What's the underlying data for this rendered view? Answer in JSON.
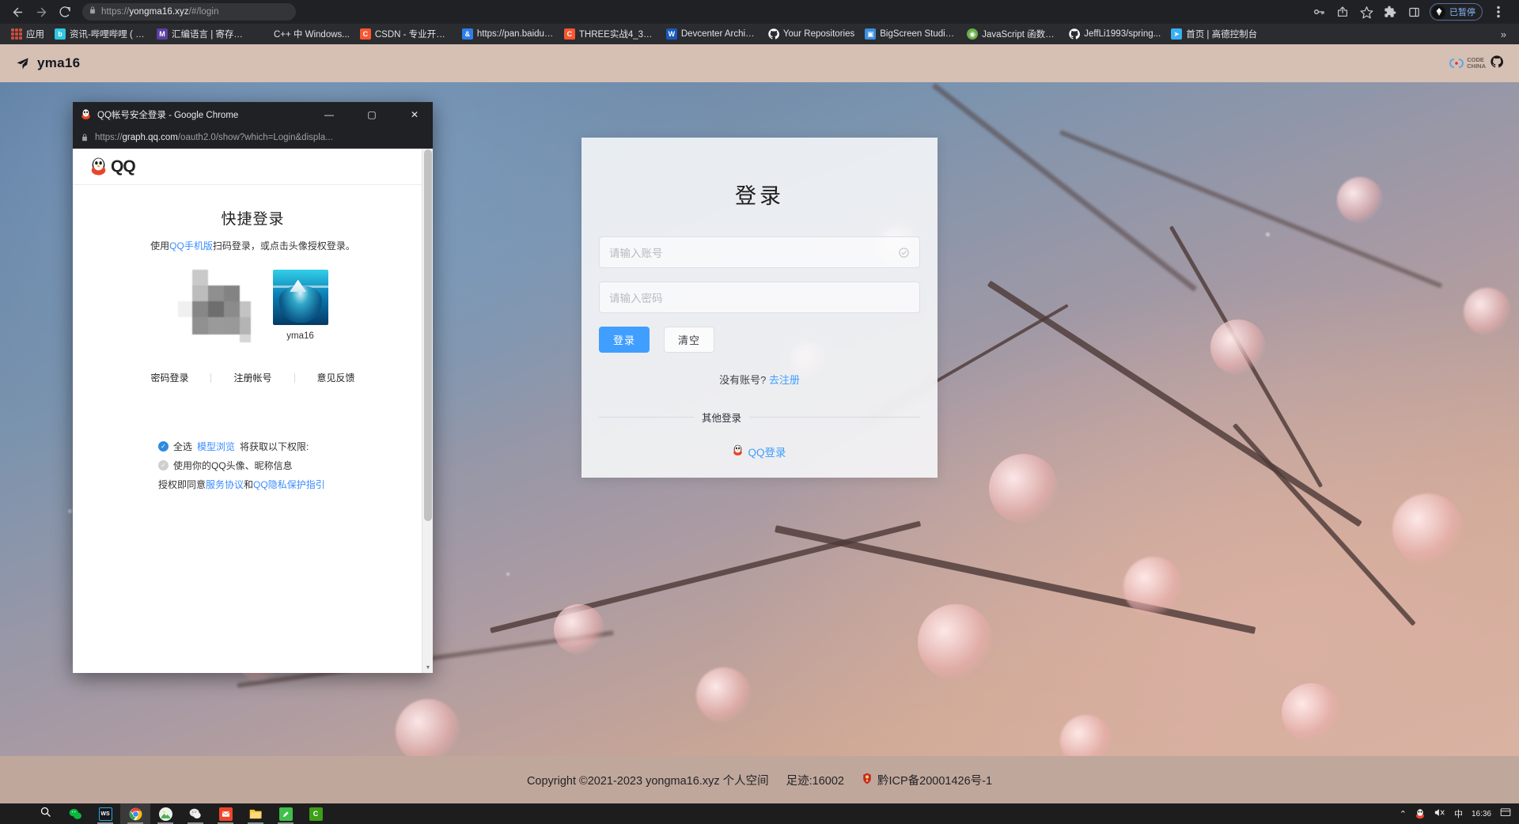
{
  "browser": {
    "nav": {
      "back_icon": "arrow-left-icon",
      "forward_icon": "arrow-right-icon",
      "reload_icon": "reload-icon",
      "lock_icon": "lock-icon",
      "url_prefix": "https://",
      "url_domain": "yongma16.xyz",
      "url_path": "/#/login",
      "full_url": "https://yongma16.xyz/#/login"
    },
    "actions": {
      "key_icon": "key-icon",
      "share_icon": "share-icon",
      "bookmark_icon": "star-icon",
      "extensions_icon": "puzzle-icon",
      "sidepanel_icon": "side-panel-icon",
      "menu_icon": "three-dot-menu-icon",
      "ext_badge_label": "已暂停"
    },
    "bookmarks": {
      "apps_label": "应用",
      "overflow_label": "»",
      "items": [
        {
          "label": "资讯-哔哩哔哩 ( °-...",
          "color": "#2ec7e0",
          "glyph": "b"
        },
        {
          "label": "汇编语言 | 寄存器 -...",
          "color": "#5b3fa3",
          "glyph": "M"
        },
        {
          "label": "C++ 中 Windows...",
          "color": "#f25022",
          "glyph": ""
        },
        {
          "label": "CSDN - 专业开发...",
          "color": "#fc5531",
          "glyph": "C"
        },
        {
          "label": "https://pan.baidu....",
          "color": "#2f7fe8",
          "glyph": "&"
        },
        {
          "label": "THREE实战4_3D纹...",
          "color": "#fc5531",
          "glyph": "C"
        },
        {
          "label": "Devcenter Archive...",
          "color": "#185abd",
          "glyph": "W"
        },
        {
          "label": "Your Repositories",
          "color": "#ffffff",
          "glyph": "O"
        },
        {
          "label": "BigScreen Studio...",
          "color": "#3b8fe0",
          "glyph": "B"
        },
        {
          "label": "JavaScript 函数定...",
          "color": "#6ab04c",
          "glyph": "J"
        },
        {
          "label": "JeffLi1993/spring...",
          "color": "#ffffff",
          "glyph": "O"
        },
        {
          "label": "首页 | 高德控制台",
          "color": "#38b0f5",
          "glyph": "A"
        }
      ]
    }
  },
  "site": {
    "header": {
      "logo_icon": "paper-plane-icon",
      "brand": "yma16",
      "codechina_line1": "CODE",
      "codechina_line2": "CHINA",
      "github_icon": "github-icon"
    },
    "login": {
      "title": "登录",
      "account_placeholder": "请输入账号",
      "account_value": "",
      "account_suffix_icon": "circle-check-icon",
      "password_placeholder": "请输入密码",
      "password_value": "",
      "submit_label": "登录",
      "clear_label": "清空",
      "signup_prompt": "没有账号?",
      "signup_link": "去注册",
      "divider_label": "其他登录",
      "qq_login_label": "QQ登录",
      "qq_icon": "qq-penguin-icon",
      "primary_color": "#409eff"
    },
    "footer": {
      "copyright": "Copyright ©2021-2023 yongma16.xyz 个人空间",
      "visits": "足迹:16002",
      "icp_icon": "police-badge-icon",
      "icp": "黔ICP备20001426号-1"
    }
  },
  "qq_window": {
    "title": "QQ帐号安全登录 - Google Chrome",
    "title_icon": "qq-penguin-icon",
    "minimize_label": "—",
    "maximize_label": "▢",
    "close_label": "✕",
    "lock_icon": "lock-icon",
    "url_prefix": "https://",
    "url_domain": "graph.qq.com",
    "url_path": "/oauth2.0/show?which=Login&displa...",
    "brand_label": "QQ",
    "heading": "快捷登录",
    "subtitle_pre": "使用",
    "subtitle_link": "QQ手机版",
    "subtitle_post": "扫码登录，或点击头像授权登录。",
    "avatar_name": "yma16",
    "links": [
      "密码登录",
      "注册帐号",
      "意见反馈"
    ],
    "permissions": {
      "row1_check": "全选",
      "row1_app": "模型浏览",
      "row1_tail": "将获取以下权限:",
      "row2": "使用你的QQ头像、昵称信息",
      "note_pre": "授权即同意",
      "note_link1": "服务协议",
      "note_mid": "和",
      "note_link2": "QQ隐私保护指引"
    }
  },
  "taskbar": {
    "items": [
      {
        "name": "start-button",
        "glyph": "",
        "color": "#ffffff",
        "active": false,
        "running": false
      },
      {
        "name": "search-button",
        "glyph": "",
        "color": "#ffffff",
        "active": false,
        "running": false
      },
      {
        "name": "wechat-taskbar",
        "glyph": "",
        "color": "#09b83e",
        "active": false,
        "running": false
      },
      {
        "name": "wps-taskbar",
        "glyph": "WS",
        "color": "#1a1a1a",
        "active": false,
        "running": true
      },
      {
        "name": "chrome-taskbar",
        "glyph": "",
        "color": "#4285f4",
        "active": true,
        "running": true
      },
      {
        "name": "picture-taskbar",
        "glyph": "",
        "color": "#8fd6a0",
        "active": false,
        "running": true
      },
      {
        "name": "qqchat-taskbar",
        "glyph": "",
        "color": "#e8e8e8",
        "active": false,
        "running": true
      },
      {
        "name": "foxmail-taskbar",
        "glyph": "",
        "color": "#f0452a",
        "active": false,
        "running": true
      },
      {
        "name": "explorer-taskbar",
        "glyph": "",
        "color": "#ffc53d",
        "active": false,
        "running": true
      },
      {
        "name": "editor-taskbar",
        "glyph": "",
        "color": "#3ec04a",
        "active": false,
        "running": true
      },
      {
        "name": "typora-taskbar",
        "glyph": "C",
        "color": "#3d9e18",
        "active": false,
        "running": false
      }
    ],
    "tray": {
      "chevron": "⌃",
      "qq_icon": "qq-penguin-icon",
      "volume_icon": "volume-muted-icon",
      "ime_label": "中",
      "clock": "16:36",
      "notify_icon": "notification-icon"
    }
  }
}
